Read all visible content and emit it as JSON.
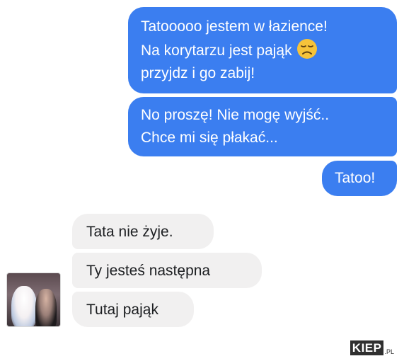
{
  "conversation": {
    "outgoing": [
      {
        "lines": [
          "Tatooooo jestem w łazience!",
          "Na korytarzu jest pająk",
          "przyjdz i go zabij!"
        ],
        "emoji": "disappointed-face"
      },
      {
        "lines": [
          "No proszę! Nie mogę wyjść..",
          "Chce mi się płakać..."
        ]
      },
      {
        "lines": [
          "Tatoo!"
        ]
      }
    ],
    "incoming": [
      {
        "text": "Tata nie żyje."
      },
      {
        "text": "Ty jesteś następna"
      },
      {
        "text": "Tutaj pająk"
      }
    ]
  },
  "colors": {
    "outgoing_bubble": "#3b7ef0",
    "incoming_bubble": "#f1f0f0"
  },
  "watermark": {
    "brand": "KIEP",
    "tld": ".PL"
  }
}
